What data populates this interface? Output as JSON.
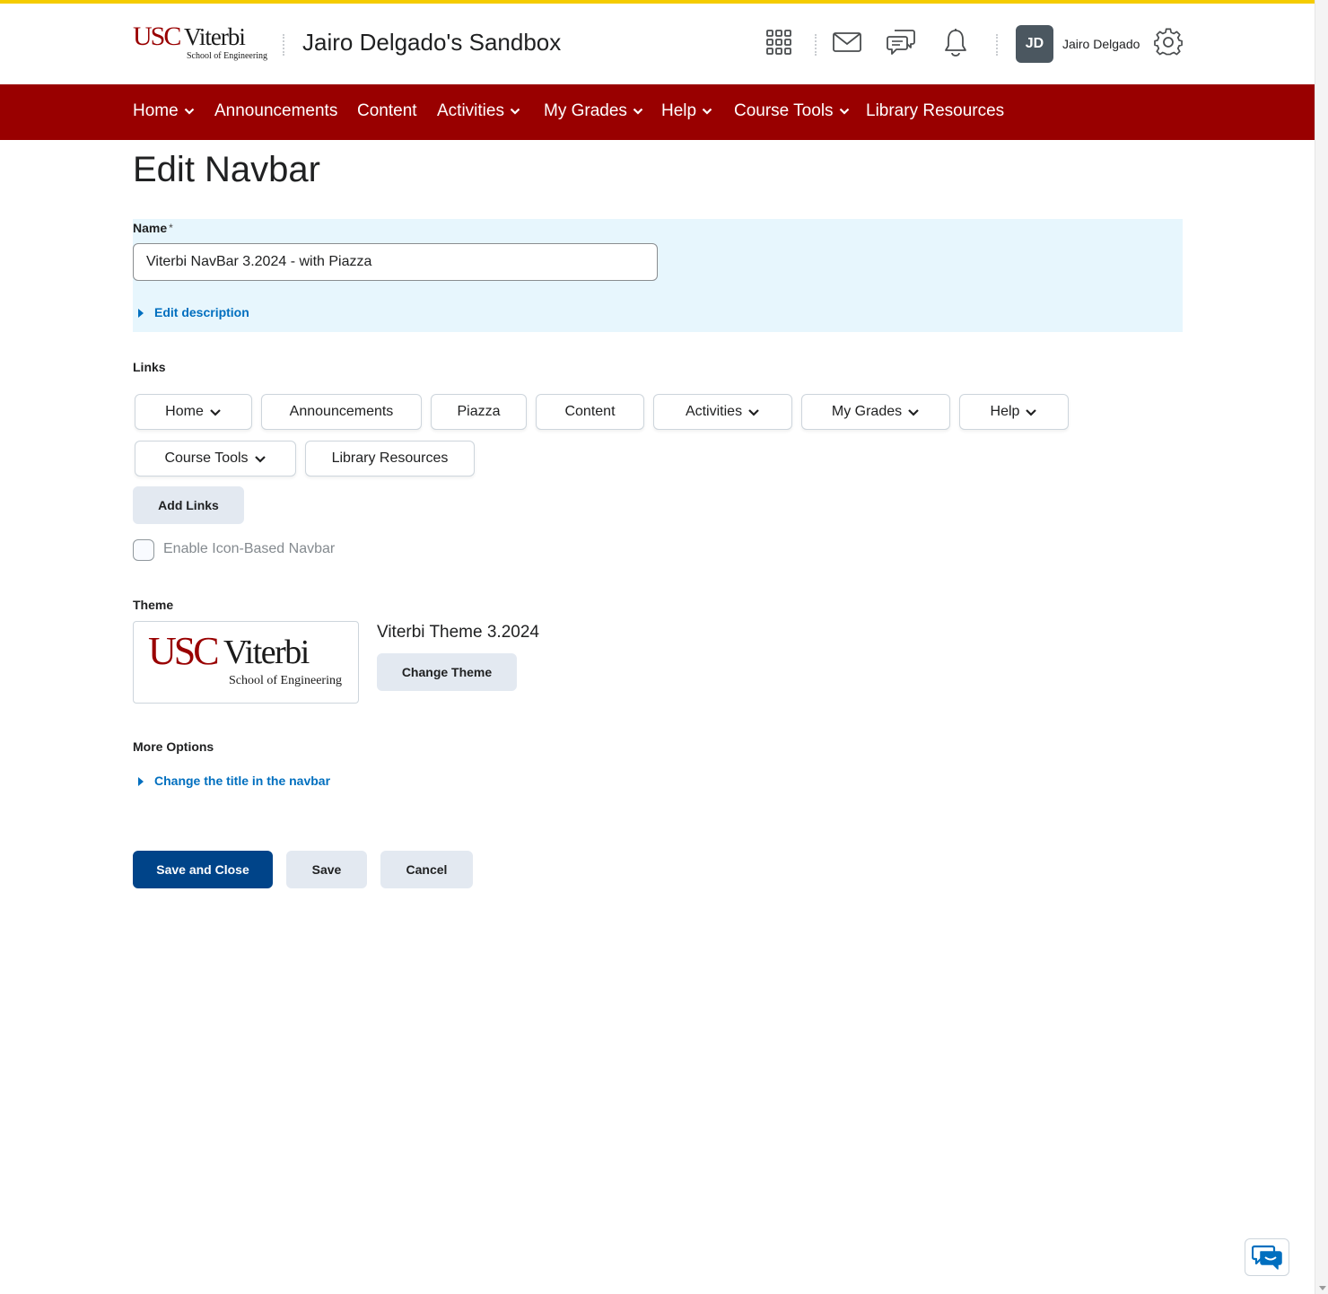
{
  "header": {
    "logo": {
      "usc": "USC",
      "viterbi": "Viterbi",
      "subtitle": "School of Engineering"
    },
    "course_title": "Jairo Delgado's Sandbox",
    "icons": [
      "apps-grid-icon",
      "mail-icon",
      "discussions-icon",
      "bell-icon",
      "gear-icon"
    ],
    "user": {
      "initials": "JD",
      "name": "Jairo Delgado"
    }
  },
  "navbar": {
    "items": [
      {
        "label": "Home",
        "dropdown": true
      },
      {
        "label": "Announcements",
        "dropdown": false
      },
      {
        "label": "Content",
        "dropdown": false
      },
      {
        "label": "Activities",
        "dropdown": true
      },
      {
        "label": "My Grades",
        "dropdown": true
      },
      {
        "label": "Help",
        "dropdown": true
      },
      {
        "label": "Course Tools",
        "dropdown": true
      },
      {
        "label": "Library Resources",
        "dropdown": false
      }
    ]
  },
  "page": {
    "title": "Edit Navbar",
    "name_label": "Name",
    "required_mark": "*",
    "name_value": "Viterbi NavBar 3.2024 - with Piazza",
    "edit_description": "Edit description",
    "links_label": "Links",
    "links": [
      {
        "label": "Home",
        "dropdown": true
      },
      {
        "label": "Announcements",
        "dropdown": false
      },
      {
        "label": "Piazza",
        "dropdown": false
      },
      {
        "label": "Content",
        "dropdown": false
      },
      {
        "label": "Activities",
        "dropdown": true
      },
      {
        "label": "My Grades",
        "dropdown": true
      },
      {
        "label": "Help",
        "dropdown": true
      },
      {
        "label": "Course Tools",
        "dropdown": true
      },
      {
        "label": "Library Resources",
        "dropdown": false
      }
    ],
    "add_links": "Add Links",
    "icon_navbar_label": "Enable Icon-Based Navbar",
    "icon_navbar_checked": false,
    "theme_label": "Theme",
    "theme_name": "Viterbi Theme 3.2024",
    "change_theme": "Change Theme",
    "more_options_label": "More Options",
    "change_title": "Change the title in the navbar",
    "save_and_close": "Save and Close",
    "save": "Save",
    "cancel": "Cancel"
  },
  "colors": {
    "navbar_bg": "#990000",
    "top_stripe": "#f5cc00",
    "primary_button": "#004489",
    "link": "#006fbf",
    "name_panel_bg": "#e7f6fd"
  }
}
